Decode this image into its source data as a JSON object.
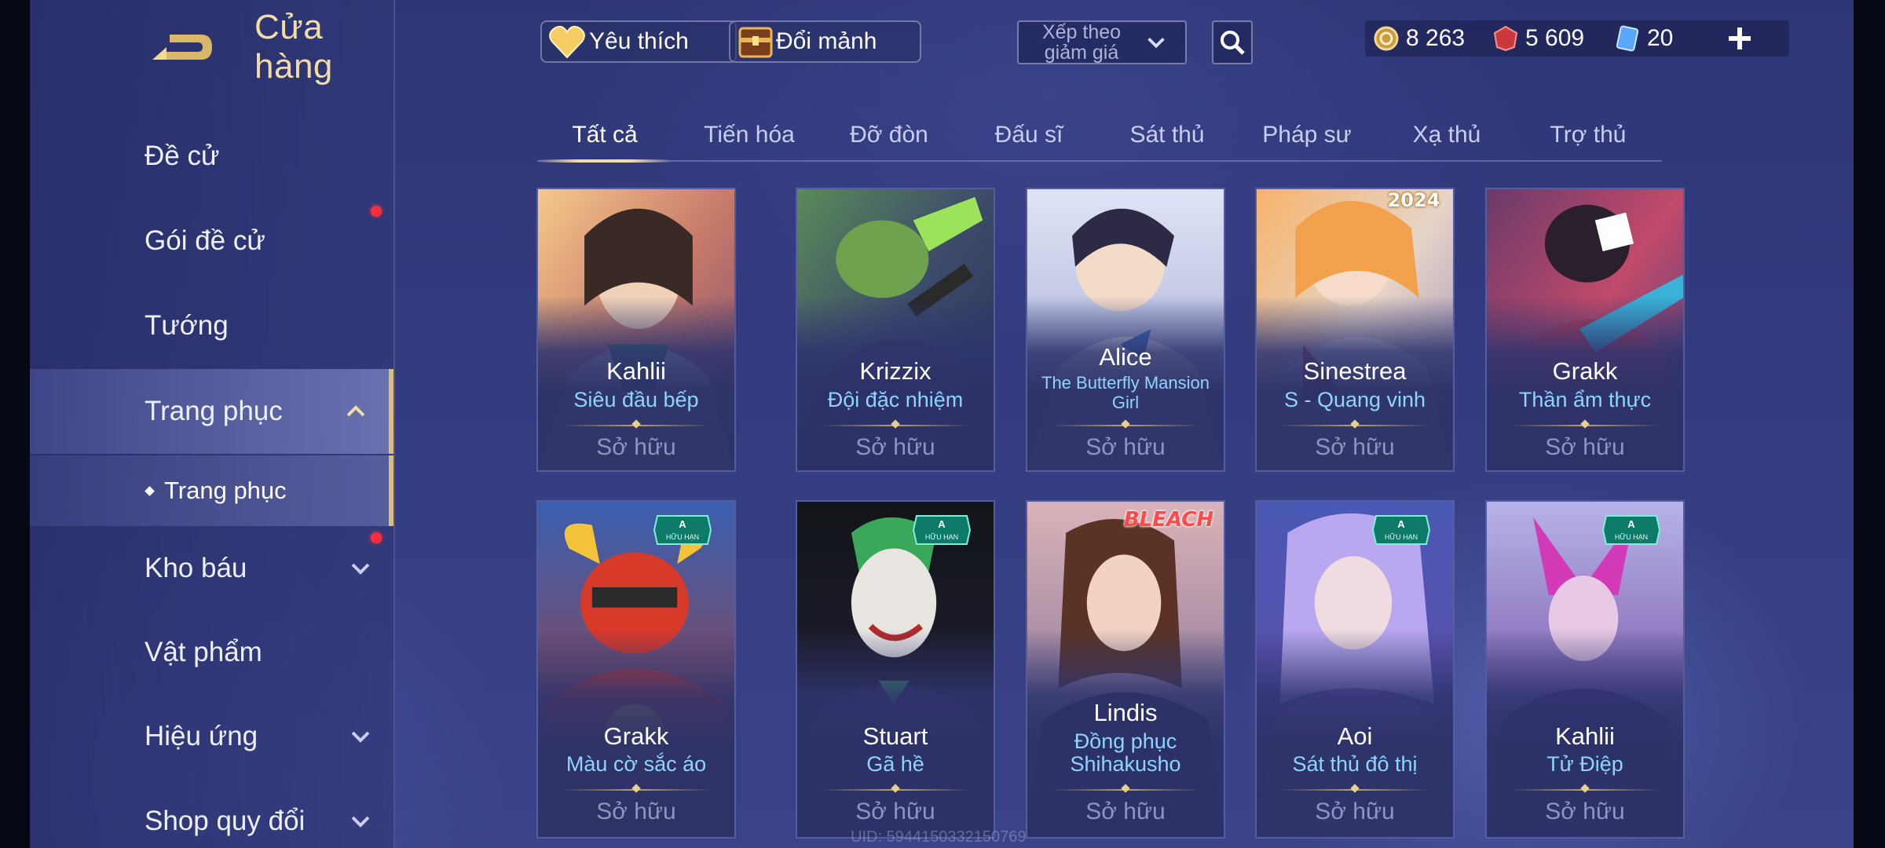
{
  "header": {
    "title": "Cửa hàng",
    "back_icon": "back-arrow-icon"
  },
  "sidebar": {
    "items": [
      {
        "label": "Đề cử",
        "has_dot": false,
        "chevron": ""
      },
      {
        "label": "Gói đề cử",
        "has_dot": true,
        "chevron": ""
      },
      {
        "label": "Tướng",
        "has_dot": false,
        "chevron": ""
      },
      {
        "label": "Trang phục",
        "has_dot": false,
        "chevron": "up",
        "active": true
      },
      {
        "label": "Kho báu",
        "has_dot": true,
        "chevron": "down"
      },
      {
        "label": "Vật phẩm",
        "has_dot": false,
        "chevron": ""
      },
      {
        "label": "Hiệu ứng",
        "has_dot": false,
        "chevron": "down"
      },
      {
        "label": "Shop quy đổi",
        "has_dot": false,
        "chevron": "down"
      }
    ],
    "sub_item": {
      "label": "Trang phục"
    }
  },
  "topbar": {
    "favorite_label": "Yêu thích",
    "exchange_label": "Đổi mảnh",
    "sort_label": "Xếp theo giảm giá",
    "currencies": [
      {
        "icon": "gold-coin-icon",
        "value": "8 263"
      },
      {
        "icon": "red-voucher-icon",
        "value": "5 609"
      },
      {
        "icon": "blue-ticket-icon",
        "value": "20"
      }
    ]
  },
  "tabs": [
    "Tất cả",
    "Tiến hóa",
    "Đỡ đòn",
    "Đấu sĩ",
    "Sát thủ",
    "Pháp sư",
    "Xạ thủ",
    "Trợ thủ"
  ],
  "active_tab": "Tất cả",
  "cards": [
    {
      "hero": "Kahlii",
      "skin": "Siêu đầu bếp",
      "status": "Sở hữu",
      "badge": ""
    },
    {
      "hero": "Krizzix",
      "skin": "Đội đặc nhiệm",
      "status": "Sở hữu",
      "badge": ""
    },
    {
      "hero": "Alice",
      "skin": "The Butterfly Mansion Girl",
      "status": "Sở hữu",
      "badge": ""
    },
    {
      "hero": "Sinestrea",
      "skin": "S - Quang vinh",
      "status": "Sở hữu",
      "badge": "2024"
    },
    {
      "hero": "Grakk",
      "skin": "Thần ẩm thực",
      "status": "Sở hữu",
      "badge": ""
    },
    {
      "hero": "Grakk",
      "skin": "Màu cờ sắc áo",
      "status": "Sở hữu",
      "badge": "A HỮU HẠN"
    },
    {
      "hero": "Stuart",
      "skin": "Gã hề",
      "status": "Sở hữu",
      "badge": "A HỮU HẠN"
    },
    {
      "hero": "Lindis",
      "skin": "Đồng phục Shihakusho",
      "status": "Sở hữu",
      "badge": "BLEACH"
    },
    {
      "hero": "Aoi",
      "skin": "Sát thủ đô thị",
      "status": "Sở hữu",
      "badge": "A HỮU HẠN"
    },
    {
      "hero": "Kahlii",
      "skin": "Tử Điệp",
      "status": "Sở hữu",
      "badge": "A HỮU HẠN"
    }
  ],
  "uid_text": "UID: 5944150332150769",
  "colors": {
    "accent_gold": "#f1dca6",
    "skin_name": "#8fd3ff",
    "owned": "#8f94bf",
    "alert_dot": "#ff2d3c"
  }
}
